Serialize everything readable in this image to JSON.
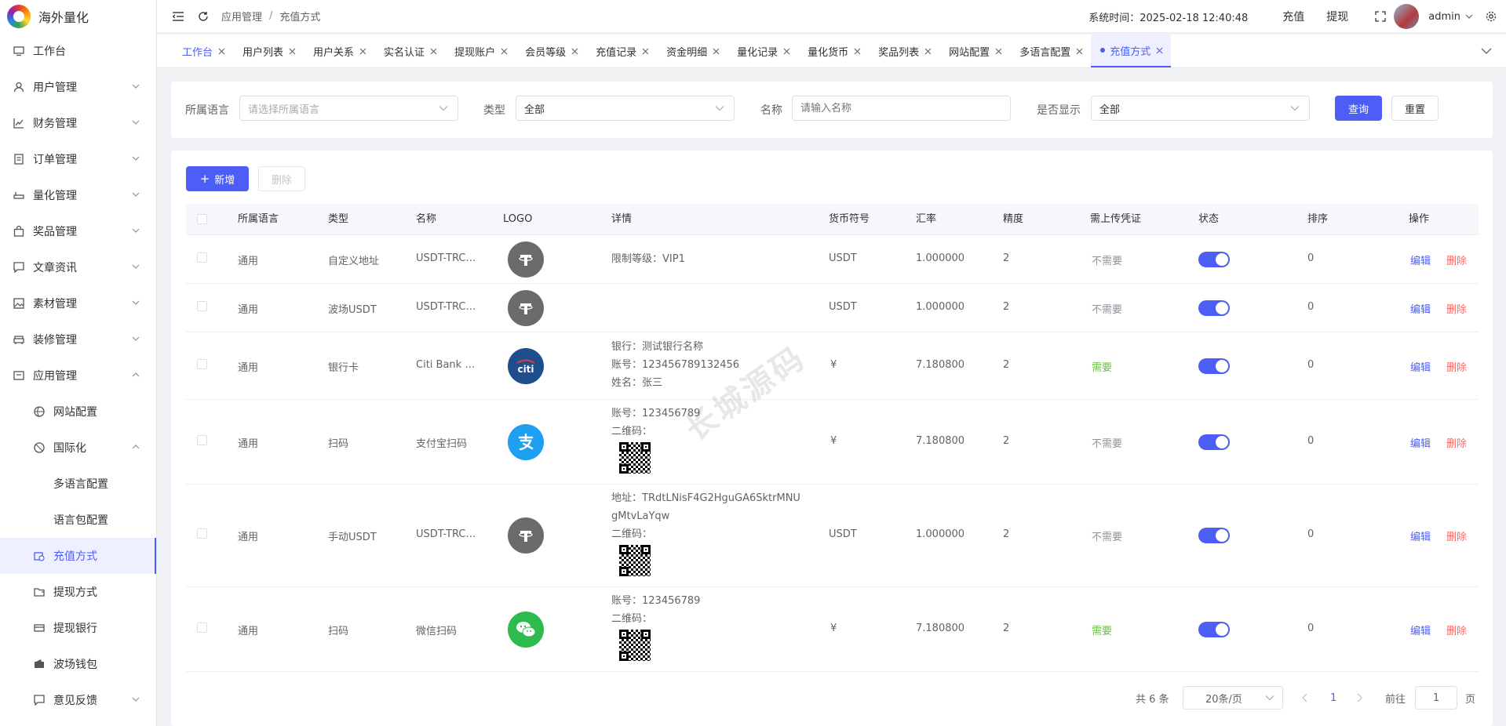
{
  "app": {
    "title": "海外量化"
  },
  "sidebar": {
    "items": [
      {
        "label": "工作台",
        "icon": "monitor-icon"
      },
      {
        "label": "用户管理",
        "icon": "user-icon"
      },
      {
        "label": "财务管理",
        "icon": "chart-icon"
      },
      {
        "label": "订单管理",
        "icon": "document-icon"
      },
      {
        "label": "量化管理",
        "icon": "tool-icon"
      },
      {
        "label": "奖品管理",
        "icon": "bag-icon"
      },
      {
        "label": "文章资讯",
        "icon": "message-icon"
      },
      {
        "label": "素材管理",
        "icon": "picture-icon"
      },
      {
        "label": "装修管理",
        "icon": "sofa-icon"
      },
      {
        "label": "应用管理",
        "icon": "app-icon"
      }
    ],
    "sub_items": [
      {
        "label": "网站配置",
        "icon": "basketball-icon"
      },
      {
        "label": "国际化",
        "icon": "globe-icon"
      }
    ],
    "sub2_items": [
      {
        "label": "多语言配置"
      },
      {
        "label": "语言包配置"
      }
    ],
    "more_items": [
      {
        "label": "充值方式",
        "icon": "wallet-icon"
      },
      {
        "label": "提现方式",
        "icon": "folder-icon"
      },
      {
        "label": "提现银行",
        "icon": "card-icon"
      },
      {
        "label": "波场钱包",
        "icon": "wallet-filled-icon"
      },
      {
        "label": "意见反馈",
        "icon": "chat-icon"
      }
    ]
  },
  "header": {
    "breadcrumb": [
      "应用管理",
      "充值方式"
    ],
    "sys_time": "系统时间：2025-02-18 12:40:48",
    "recharge": "充值",
    "withdraw": "提现",
    "user": "admin"
  },
  "tabs": [
    "工作台",
    "用户列表",
    "用户关系",
    "实名认证",
    "提现账户",
    "会员等级",
    "充值记录",
    "资金明细",
    "量化记录",
    "量化货币",
    "奖品列表",
    "网站配置",
    "多语言配置",
    "充值方式"
  ],
  "filter": {
    "lang_label": "所属语言",
    "lang_placeholder": "请选择所属语言",
    "type_label": "类型",
    "type_value": "全部",
    "name_label": "名称",
    "name_placeholder": "请输入名称",
    "show_label": "是否显示",
    "show_value": "全部",
    "query": "查询",
    "reset": "重置"
  },
  "toolbar": {
    "add": "新增",
    "delete": "删除"
  },
  "table": {
    "headers": [
      "所属语言",
      "类型",
      "名称",
      "LOGO",
      "详情",
      "货币符号",
      "汇率",
      "精度",
      "需上传凭证",
      "状态",
      "排序",
      "操作"
    ],
    "edit": "编辑",
    "del": "删除",
    "rows": [
      {
        "lang": "通用",
        "type": "自定义地址",
        "name": "USDT-TRC…",
        "logo": "tether-logo",
        "d1": "限制等级：VIP1",
        "d2": "",
        "d3": "",
        "symbol": "USDT",
        "rate": "1.000000",
        "precision": "2",
        "proof": "不需要",
        "sort": "0"
      },
      {
        "lang": "通用",
        "type": "波场USDT",
        "name": "USDT-TRC…",
        "logo": "tether-logo",
        "d1": "",
        "d2": "",
        "d3": "",
        "symbol": "USDT",
        "rate": "1.000000",
        "precision": "2",
        "proof": "不需要",
        "sort": "0"
      },
      {
        "lang": "通用",
        "type": "银行卡",
        "name": "Citi Bank …",
        "logo": "citi-logo",
        "d1": "银行：测试银行名称",
        "d2": "账号：123456789132456",
        "d3": "姓名：张三",
        "symbol": "¥",
        "rate": "7.180800",
        "precision": "2",
        "proof": "需要",
        "sort": "0"
      },
      {
        "lang": "通用",
        "type": "扫码",
        "name": "支付宝扫码",
        "logo": "alipay-logo",
        "d1": "账号：123456789",
        "d2": "二维码：",
        "d3": "",
        "symbol": "¥",
        "rate": "7.180800",
        "precision": "2",
        "proof": "不需要",
        "sort": "0"
      },
      {
        "lang": "通用",
        "type": "手动USDT",
        "name": "USDT-TRC…",
        "logo": "tether-logo",
        "d1": "地址：TRdtLNisF4G2HguGA6SktrMNU",
        "d2": "gMtvLaYqw",
        "d3": "二维码：",
        "symbol": "USDT",
        "rate": "1.000000",
        "precision": "2",
        "proof": "不需要",
        "sort": "0"
      },
      {
        "lang": "通用",
        "type": "扫码",
        "name": "微信扫码",
        "logo": "wechat-logo",
        "d1": "账号：123456789",
        "d2": "二维码：",
        "d3": "",
        "symbol": "¥",
        "rate": "7.180800",
        "precision": "2",
        "proof": "需要",
        "sort": "0"
      }
    ]
  },
  "pagination": {
    "total": "共 6 条",
    "page_size": "20条/页",
    "current": "1",
    "goto": "前往",
    "goto_value": "1",
    "page": "页"
  },
  "watermark": "长城源码",
  "colors": {
    "accent": "#4d5ef6",
    "danger": "#f56c6c",
    "success": "#67c23a"
  }
}
